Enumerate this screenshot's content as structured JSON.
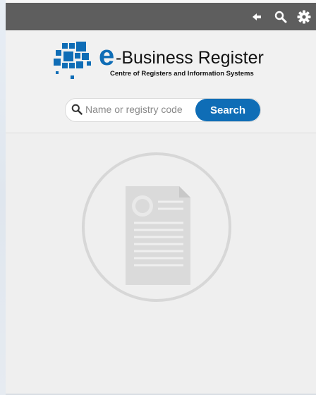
{
  "toolbar": {
    "back_icon": "arrow-left-icon",
    "search_icon": "search-icon",
    "settings_icon": "gear-icon"
  },
  "brand": {
    "letter": "e",
    "title": "-Business Register",
    "subtitle": "Centre of Registers and Information Systems",
    "color": "#0f6db6"
  },
  "search": {
    "placeholder": "Name or registry code",
    "value": "",
    "button_label": "Search"
  },
  "empty_state": {
    "icon": "document-certificate-icon"
  },
  "colors": {
    "toolbar_bg": "#5e5e5e",
    "accent": "#0f6db6",
    "background": "#efefef"
  }
}
